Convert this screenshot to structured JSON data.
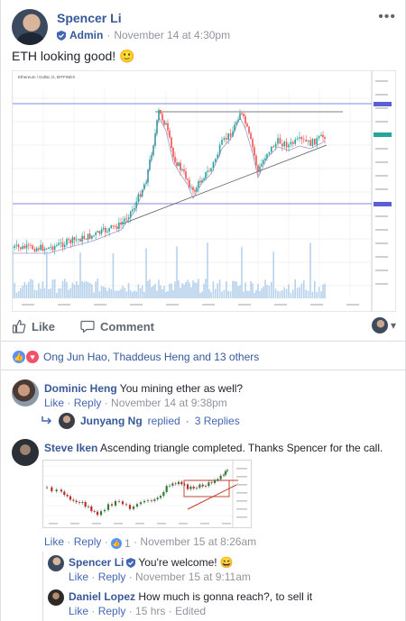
{
  "post": {
    "author": "Spencer Li",
    "role": "Admin",
    "timestamp": "November 14 at 4:30pm",
    "text": "ETH looking good! 🙂",
    "more_icon": "•••",
    "chart_header": "Ethereum / Dollar, D, BITFINEX"
  },
  "actions": {
    "like_label": "Like",
    "comment_label": "Comment",
    "viewer_dropdown": "▾"
  },
  "reactions": {
    "summary": "Ong Jun Hao, Thaddeus Heng and 13 others"
  },
  "comments": [
    {
      "author": "Dominic Heng",
      "text": "You mining ether as well?",
      "like": "Like",
      "reply": "Reply",
      "timestamp": "November 14 at 9:38pm",
      "replies_summary": {
        "name": "Junyang Ng",
        "verb": "replied",
        "count": "3 Replies"
      }
    },
    {
      "author": "Steve Iken",
      "text": "Ascending triangle completed. Thanks Spencer for the call.",
      "like": "Like",
      "reply": "Reply",
      "reaction_count": "1",
      "timestamp": "November 15 at 8:26am",
      "replies": [
        {
          "author": "Spencer Li",
          "text": "You're welcome! 😄",
          "like": "Like",
          "reply": "Reply",
          "timestamp": "November 15 at 9:11am"
        },
        {
          "author": "Daniel Lopez",
          "text": "How much is gonna reach?, to sell it",
          "like": "Like",
          "reply": "Reply",
          "timestamp": "15 hrs",
          "edited": "Edited"
        }
      ]
    }
  ],
  "colors": {
    "link": "#385898",
    "meta": "#90949c",
    "like_blue": "#5890ff",
    "love_red": "#f25268",
    "candle_up": "#26a69a",
    "candle_down": "#ef5350"
  }
}
